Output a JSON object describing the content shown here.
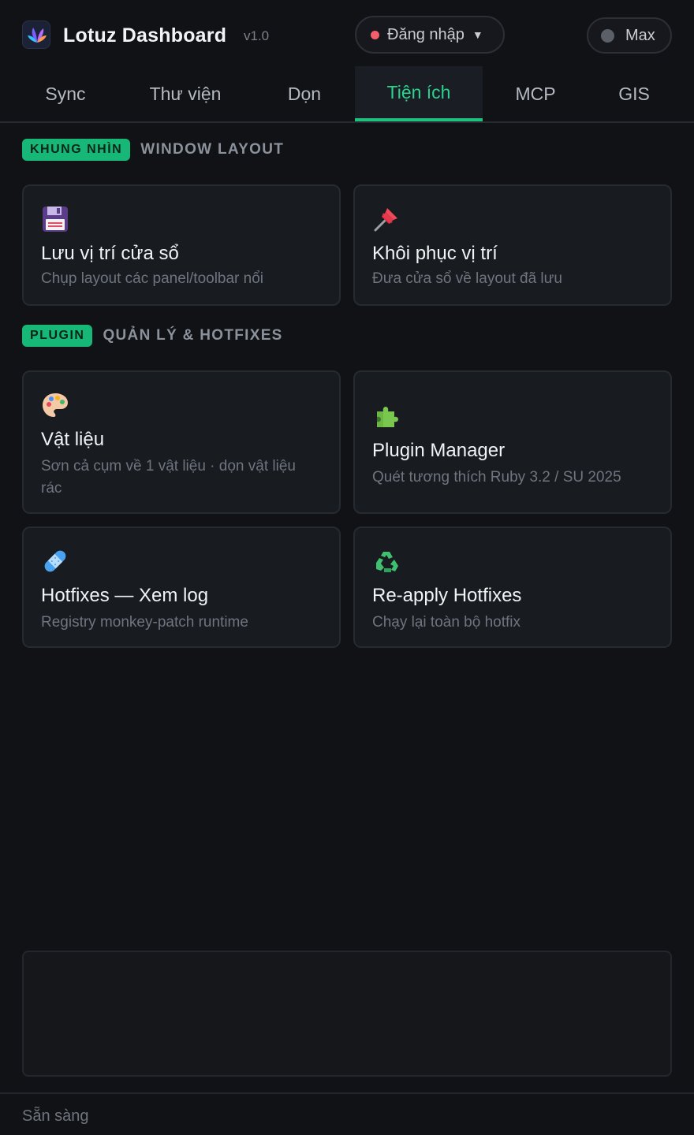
{
  "header": {
    "app_title": "Lotuz Dashboard",
    "version": "v1.0",
    "login_label": "Đăng nhập",
    "mode_label": "Max"
  },
  "tabs": [
    {
      "label": "Sync",
      "active": false
    },
    {
      "label": "Thư viện",
      "active": false
    },
    {
      "label": "Dọn",
      "active": false
    },
    {
      "label": "Tiện ích",
      "active": true
    },
    {
      "label": "MCP",
      "active": false
    },
    {
      "label": "GIS",
      "active": false
    }
  ],
  "sections": [
    {
      "pill": "KHUNG NHÌN",
      "title": "WINDOW LAYOUT",
      "cards": [
        {
          "icon": "floppy-disk-icon",
          "title": "Lưu vị trí cửa sổ",
          "desc": "Chụp layout các panel/toolbar nổi"
        },
        {
          "icon": "pushpin-icon",
          "title": "Khôi phục vị trí",
          "desc": "Đưa cửa sổ về layout đã lưu"
        }
      ]
    },
    {
      "pill": "PLUGIN",
      "title": "QUẢN LÝ & HOTFIXES",
      "cards": [
        {
          "icon": "palette-icon",
          "title": "Vật liệu",
          "desc": "Sơn cả cụm về 1 vật liệu · dọn vật liệu rác"
        },
        {
          "icon": "puzzle-icon",
          "title": "Plugin Manager",
          "desc": "Quét tương thích Ruby 3.2 / SU 2025"
        },
        {
          "icon": "bandage-icon",
          "title": "Hotfixes — Xem log",
          "desc": "Registry monkey-patch runtime"
        },
        {
          "icon": "recycle-icon",
          "title": "Re-apply Hotfixes",
          "desc": "Chạy lại toàn bộ hotfix"
        }
      ]
    }
  ],
  "status": {
    "text": "Sẵn sàng"
  },
  "colors": {
    "accent": "#1fc17f",
    "background": "#111216",
    "card": "#181b20",
    "login_dot": "#f25f6b"
  }
}
